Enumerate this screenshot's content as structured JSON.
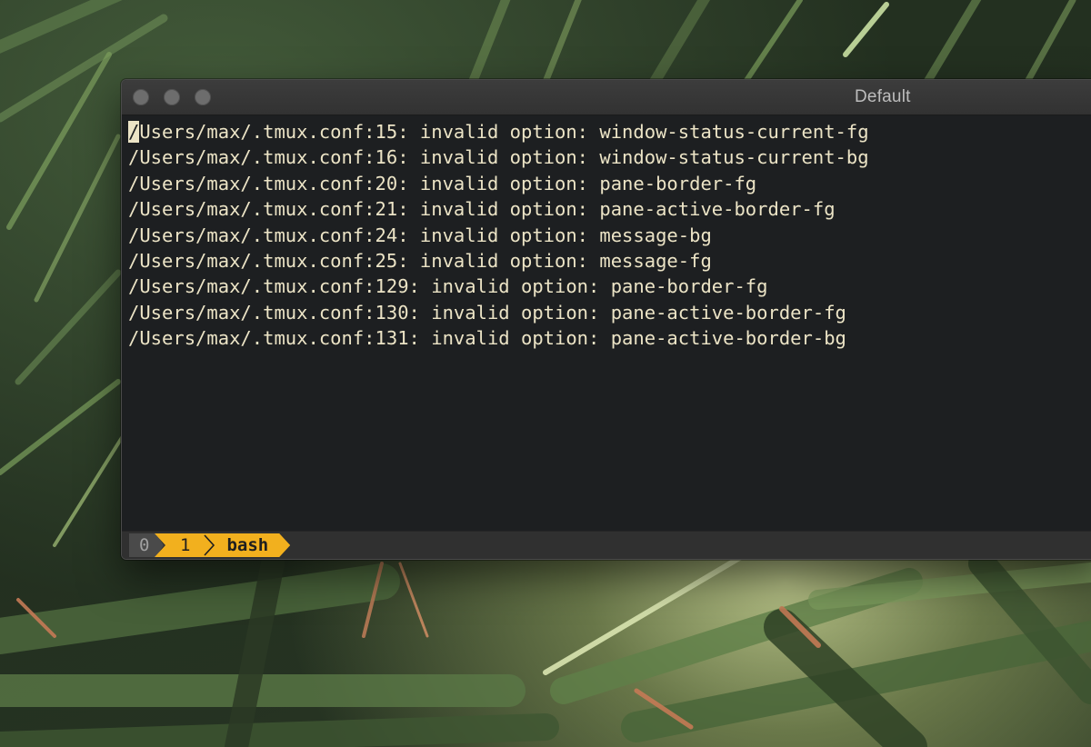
{
  "window": {
    "title": "Default"
  },
  "terminal": {
    "lines": [
      {
        "cursor_char": "/",
        "rest": "Users/max/.tmux.conf:15: invalid option: window-status-current-fg"
      },
      {
        "text": "/Users/max/.tmux.conf:16: invalid option: window-status-current-bg"
      },
      {
        "text": "/Users/max/.tmux.conf:20: invalid option: pane-border-fg"
      },
      {
        "text": "/Users/max/.tmux.conf:21: invalid option: pane-active-border-fg"
      },
      {
        "text": "/Users/max/.tmux.conf:24: invalid option: message-bg"
      },
      {
        "text": "/Users/max/.tmux.conf:25: invalid option: message-fg"
      },
      {
        "text": "/Users/max/.tmux.conf:129: invalid option: pane-border-fg"
      },
      {
        "text": "/Users/max/.tmux.conf:130: invalid option: pane-active-border-fg"
      },
      {
        "text": "/Users/max/.tmux.conf:131: invalid option: pane-active-border-bg"
      }
    ]
  },
  "statusbar": {
    "windows": [
      {
        "index": "0"
      },
      {
        "index": "1",
        "name": "bash"
      }
    ]
  },
  "colors": {
    "terminal_bg": "#1d1f21",
    "terminal_fg": "#ece4c6",
    "status_active": "#f2b01e",
    "status_inactive": "#4a4a4a"
  },
  "icons": [
    "close-icon",
    "minimize-icon",
    "zoom-icon",
    "chevron-right-icon"
  ]
}
